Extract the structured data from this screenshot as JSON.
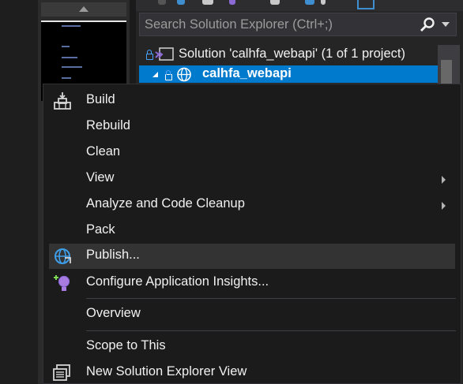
{
  "solution_explorer": {
    "search": {
      "placeholder": "Search Solution Explorer (Ctrl+;)",
      "value": ""
    },
    "tree": [
      {
        "label": "Solution 'calhfa_webapi' (1 of 1 project)"
      },
      {
        "label": "calhfa_webapi",
        "selected": true
      }
    ]
  },
  "context_menu": {
    "items": [
      {
        "label": "Build",
        "icon": "build-icon"
      },
      {
        "label": "Rebuild"
      },
      {
        "label": "Clean"
      },
      {
        "label": "View",
        "submenu": true
      },
      {
        "label": "Analyze and Code Cleanup",
        "submenu": true
      },
      {
        "label": "Pack"
      },
      {
        "label": "Publish...",
        "icon": "publish-globe-icon",
        "hovered": true
      },
      {
        "label": "Configure Application Insights...",
        "icon": "application-insights-icon"
      },
      {
        "label": "Overview"
      },
      {
        "label": "Scope to This"
      },
      {
        "label": "New Solution Explorer View",
        "icon": "new-explorer-view-icon"
      }
    ]
  },
  "colors": {
    "selection": "#007acc",
    "menu_background": "#1b1b1c",
    "hover": "#333334",
    "accent_blue": "#4aa3ff",
    "vs_purple": "#8c6ad6"
  }
}
